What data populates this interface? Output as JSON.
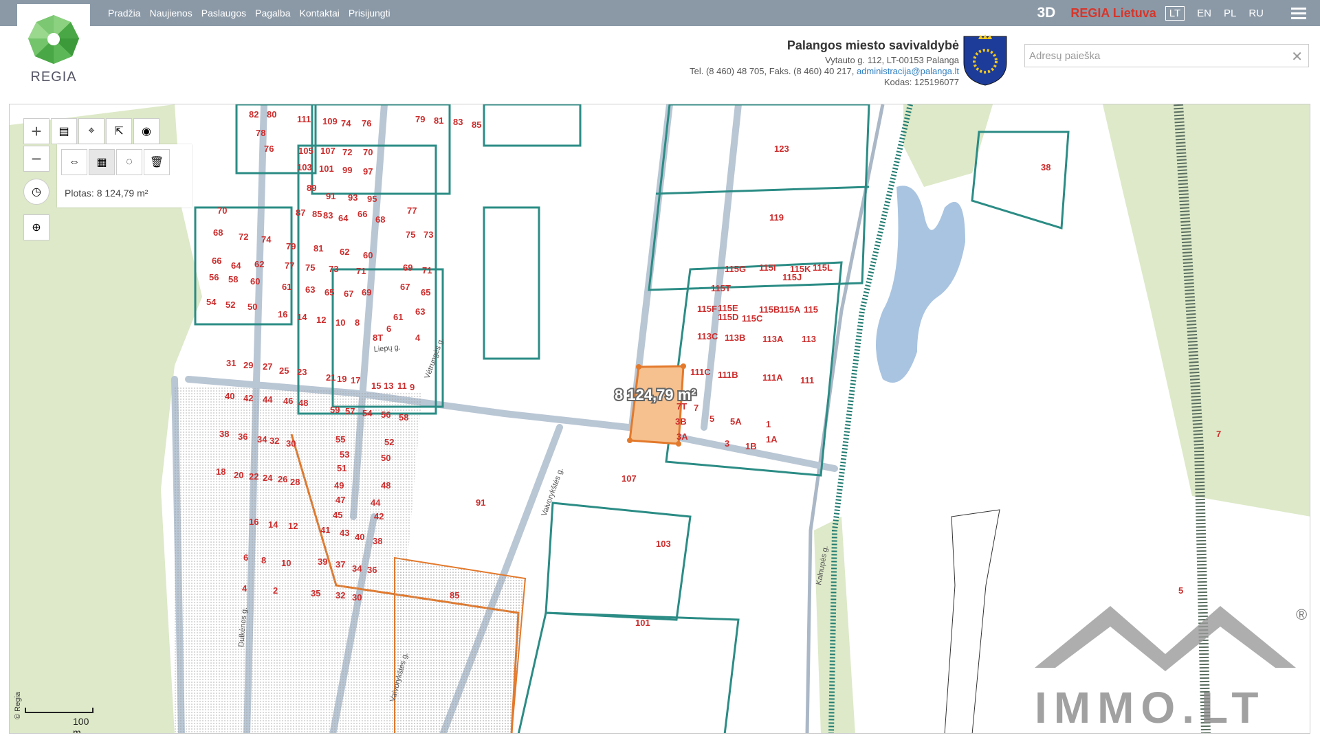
{
  "nav": [
    "Pradžia",
    "Naujienos",
    "Paslaugos",
    "Pagalba",
    "Kontaktai",
    "Prisijungti"
  ],
  "topbar": {
    "btn_3d": "3D",
    "brand": "REGIA Lietuva",
    "langs": [
      "LT",
      "EN",
      "PL",
      "RU"
    ],
    "active_lang": "LT"
  },
  "logo": {
    "text": "REGIA"
  },
  "municipality": {
    "title": "Palangos miesto savivaldybė",
    "address": "Vytauto g. 112, LT-00153 Palanga",
    "phone": "Tel. (8 460) 48 705, Faks. (8 460) 40 217,",
    "email": "administracija@palanga.lt",
    "code": "Kodas: 125196077"
  },
  "search": {
    "placeholder": "Adresų paieška",
    "value": ""
  },
  "map": {
    "area_label": "Plotas: 8 124,79 m²",
    "measure_label": "8 124,79 m²",
    "scale": "100 m",
    "copyright": "© Regia",
    "parcels": [
      {
        "t": "82"
      },
      {
        "t": "80"
      },
      {
        "t": "78"
      },
      {
        "t": "76"
      },
      {
        "t": "111"
      },
      {
        "t": "109"
      },
      {
        "t": "74"
      },
      {
        "t": "76"
      },
      {
        "t": "79"
      },
      {
        "t": "81"
      },
      {
        "t": "83"
      },
      {
        "t": "85"
      },
      {
        "t": "105"
      },
      {
        "t": "107"
      },
      {
        "t": "72"
      },
      {
        "t": "70"
      },
      {
        "t": "103"
      },
      {
        "t": "101"
      },
      {
        "t": "99"
      },
      {
        "t": "97"
      },
      {
        "t": "89"
      },
      {
        "t": "91"
      },
      {
        "t": "93"
      },
      {
        "t": "95"
      },
      {
        "t": "87"
      },
      {
        "t": "85"
      },
      {
        "t": "83"
      },
      {
        "t": "64"
      },
      {
        "t": "66"
      },
      {
        "t": "68"
      },
      {
        "t": "77"
      },
      {
        "t": "70"
      },
      {
        "t": "68"
      },
      {
        "t": "72"
      },
      {
        "t": "74"
      },
      {
        "t": "75"
      },
      {
        "t": "73"
      },
      {
        "t": "79"
      },
      {
        "t": "81"
      },
      {
        "t": "62"
      },
      {
        "t": "60"
      },
      {
        "t": "66"
      },
      {
        "t": "64"
      },
      {
        "t": "62"
      },
      {
        "t": "77"
      },
      {
        "t": "75"
      },
      {
        "t": "73"
      },
      {
        "t": "71"
      },
      {
        "t": "69"
      },
      {
        "t": "71"
      },
      {
        "t": "56"
      },
      {
        "t": "58"
      },
      {
        "t": "60"
      },
      {
        "t": "61"
      },
      {
        "t": "63"
      },
      {
        "t": "65"
      },
      {
        "t": "67"
      },
      {
        "t": "69"
      },
      {
        "t": "67"
      },
      {
        "t": "65"
      },
      {
        "t": "54"
      },
      {
        "t": "52"
      },
      {
        "t": "50"
      },
      {
        "t": "16"
      },
      {
        "t": "14"
      },
      {
        "t": "12"
      },
      {
        "t": "10"
      },
      {
        "t": "8"
      },
      {
        "t": "61"
      },
      {
        "t": "63"
      },
      {
        "t": "6"
      },
      {
        "t": "4"
      },
      {
        "t": "8T"
      },
      {
        "t": "123"
      },
      {
        "t": "119"
      },
      {
        "t": "38"
      },
      {
        "t": "115G"
      },
      {
        "t": "115I"
      },
      {
        "t": "115K"
      },
      {
        "t": "115L"
      },
      {
        "t": "115J"
      },
      {
        "t": "115T"
      },
      {
        "t": "115F"
      },
      {
        "t": "115E"
      },
      {
        "t": "115B"
      },
      {
        "t": "115A"
      },
      {
        "t": "115"
      },
      {
        "t": "115D"
      },
      {
        "t": "115C"
      },
      {
        "t": "113C"
      },
      {
        "t": "113B"
      },
      {
        "t": "113A"
      },
      {
        "t": "113"
      },
      {
        "t": "111C"
      },
      {
        "t": "111B"
      },
      {
        "t": "111A"
      },
      {
        "t": "111"
      },
      {
        "t": "7T"
      },
      {
        "t": "7"
      },
      {
        "t": "3B"
      },
      {
        "t": "5"
      },
      {
        "t": "5A"
      },
      {
        "t": "1"
      },
      {
        "t": "3A"
      },
      {
        "t": "3"
      },
      {
        "t": "1B"
      },
      {
        "t": "1A"
      },
      {
        "t": "107"
      },
      {
        "t": "91"
      },
      {
        "t": "103"
      },
      {
        "t": "85"
      },
      {
        "t": "101"
      },
      {
        "t": "31"
      },
      {
        "t": "29"
      },
      {
        "t": "27"
      },
      {
        "t": "25"
      },
      {
        "t": "23"
      },
      {
        "t": "21"
      },
      {
        "t": "19"
      },
      {
        "t": "17"
      },
      {
        "t": "15"
      },
      {
        "t": "13"
      },
      {
        "t": "11"
      },
      {
        "t": "9"
      },
      {
        "t": "40"
      },
      {
        "t": "42"
      },
      {
        "t": "44"
      },
      {
        "t": "46"
      },
      {
        "t": "48"
      },
      {
        "t": "59"
      },
      {
        "t": "57"
      },
      {
        "t": "54"
      },
      {
        "t": "56"
      },
      {
        "t": "58"
      },
      {
        "t": "38"
      },
      {
        "t": "36"
      },
      {
        "t": "34"
      },
      {
        "t": "32"
      },
      {
        "t": "30"
      },
      {
        "t": "55"
      },
      {
        "t": "53"
      },
      {
        "t": "52"
      },
      {
        "t": "50"
      },
      {
        "t": "51"
      },
      {
        "t": "18"
      },
      {
        "t": "20"
      },
      {
        "t": "22"
      },
      {
        "t": "24"
      },
      {
        "t": "26"
      },
      {
        "t": "28"
      },
      {
        "t": "49"
      },
      {
        "t": "47"
      },
      {
        "t": "48"
      },
      {
        "t": "45"
      },
      {
        "t": "44"
      },
      {
        "t": "42"
      },
      {
        "t": "16"
      },
      {
        "t": "14"
      },
      {
        "t": "12"
      },
      {
        "t": "41"
      },
      {
        "t": "43"
      },
      {
        "t": "40"
      },
      {
        "t": "38"
      },
      {
        "t": "6"
      },
      {
        "t": "8"
      },
      {
        "t": "10"
      },
      {
        "t": "39"
      },
      {
        "t": "37"
      },
      {
        "t": "34"
      },
      {
        "t": "36"
      },
      {
        "t": "4"
      },
      {
        "t": "2"
      },
      {
        "t": "35"
      },
      {
        "t": "32"
      },
      {
        "t": "30"
      },
      {
        "t": "7"
      },
      {
        "t": "5"
      }
    ],
    "streets": [
      "Liepų g.",
      "Vėtrungės g.",
      "Vaivorykštės g.",
      "Dulkėnos g.",
      "Vaivorykštės g.",
      "Kalnupės g."
    ]
  },
  "watermark": {
    "text": "IMMO.LT",
    "registered": "®"
  }
}
